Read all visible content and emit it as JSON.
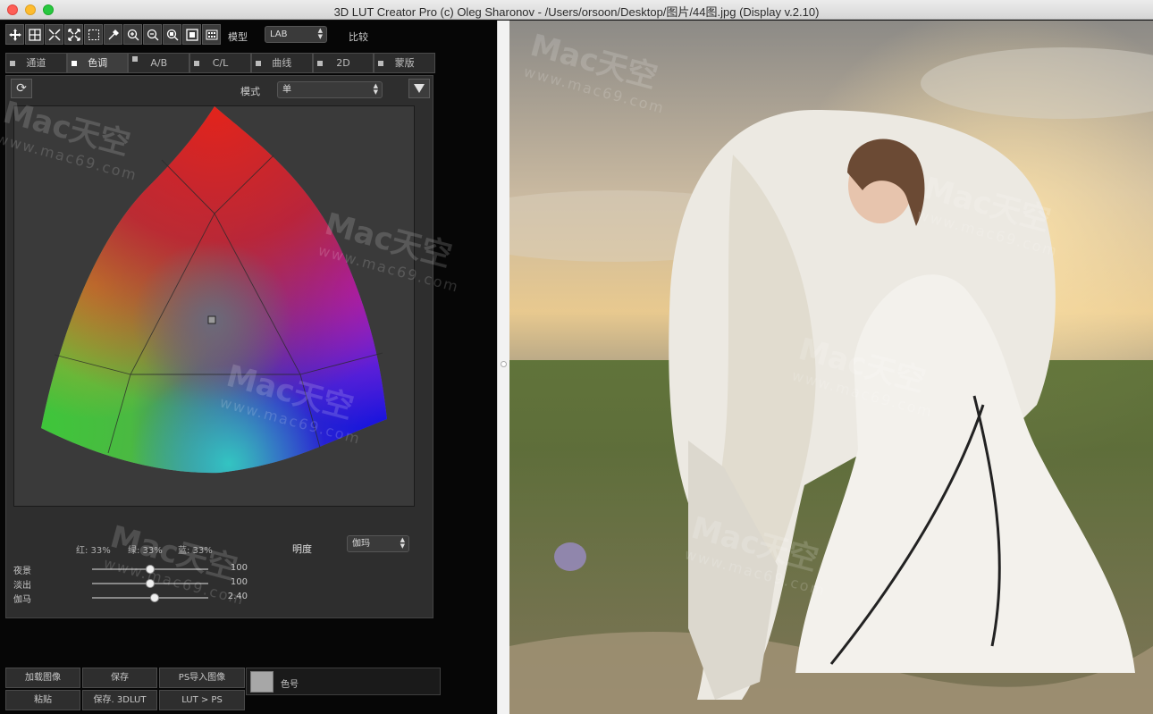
{
  "window": {
    "title": "3D LUT Creator Pro (c) Oleg Sharonov - /Users/orsoon/Desktop/图片/44图.jpg (Display v.2.10)"
  },
  "toolbar": {
    "tools": [
      "move-icon",
      "grid-icon",
      "compress-icon",
      "expand-icon",
      "marquee-icon",
      "eyedropper-icon",
      "zoom-in-icon",
      "zoom-out-icon",
      "zoom-fit-icon",
      "frame-icon",
      "grid-view-icon"
    ],
    "model_label": "模型",
    "model_value": "LAB",
    "compare_label": "比较"
  },
  "tabs": [
    {
      "label": "通道"
    },
    {
      "label": "色调"
    },
    {
      "label": "A/B"
    },
    {
      "label": "C/L"
    },
    {
      "label": "曲线"
    },
    {
      "label": "2D"
    },
    {
      "label": "蒙版"
    }
  ],
  "panel": {
    "mode_label": "模式",
    "mode_value": "单",
    "stats": {
      "red": "红: 33%",
      "green": "绿: 33%",
      "blue": "蓝: 33%"
    },
    "brightness_label": "明度",
    "brightness_value": "伽玛",
    "sliders": [
      {
        "name": "夜景",
        "value": "100",
        "level": 0.5
      },
      {
        "name": "淡出",
        "value": "100",
        "level": 0.5
      },
      {
        "name": "伽马",
        "value": "2.40",
        "level": 0.54
      }
    ]
  },
  "buttons": {
    "load_image": "加载图像",
    "save": "保存",
    "ps_import": "PS导入图像",
    "paste": "粘贴",
    "save_3dlut": "保存. 3DLUT",
    "lut_ps": "LUT > PS"
  },
  "color_label": "色号",
  "colors": {
    "swatch": "#a7a7a7",
    "accent": "#fe5f57"
  },
  "watermark": {
    "brand": "Mac天空",
    "url": "www.mac69.com"
  }
}
